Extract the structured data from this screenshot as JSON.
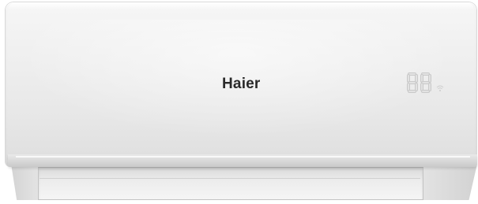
{
  "product": {
    "brand_logo": "Haier",
    "display": {
      "readout": "88",
      "indicator_icon": "wifi-icon"
    }
  },
  "colors": {
    "body": "#efefef",
    "logo": "#2a2a2a",
    "display_segment": "#e2e2e2",
    "louver": "#ececec"
  }
}
